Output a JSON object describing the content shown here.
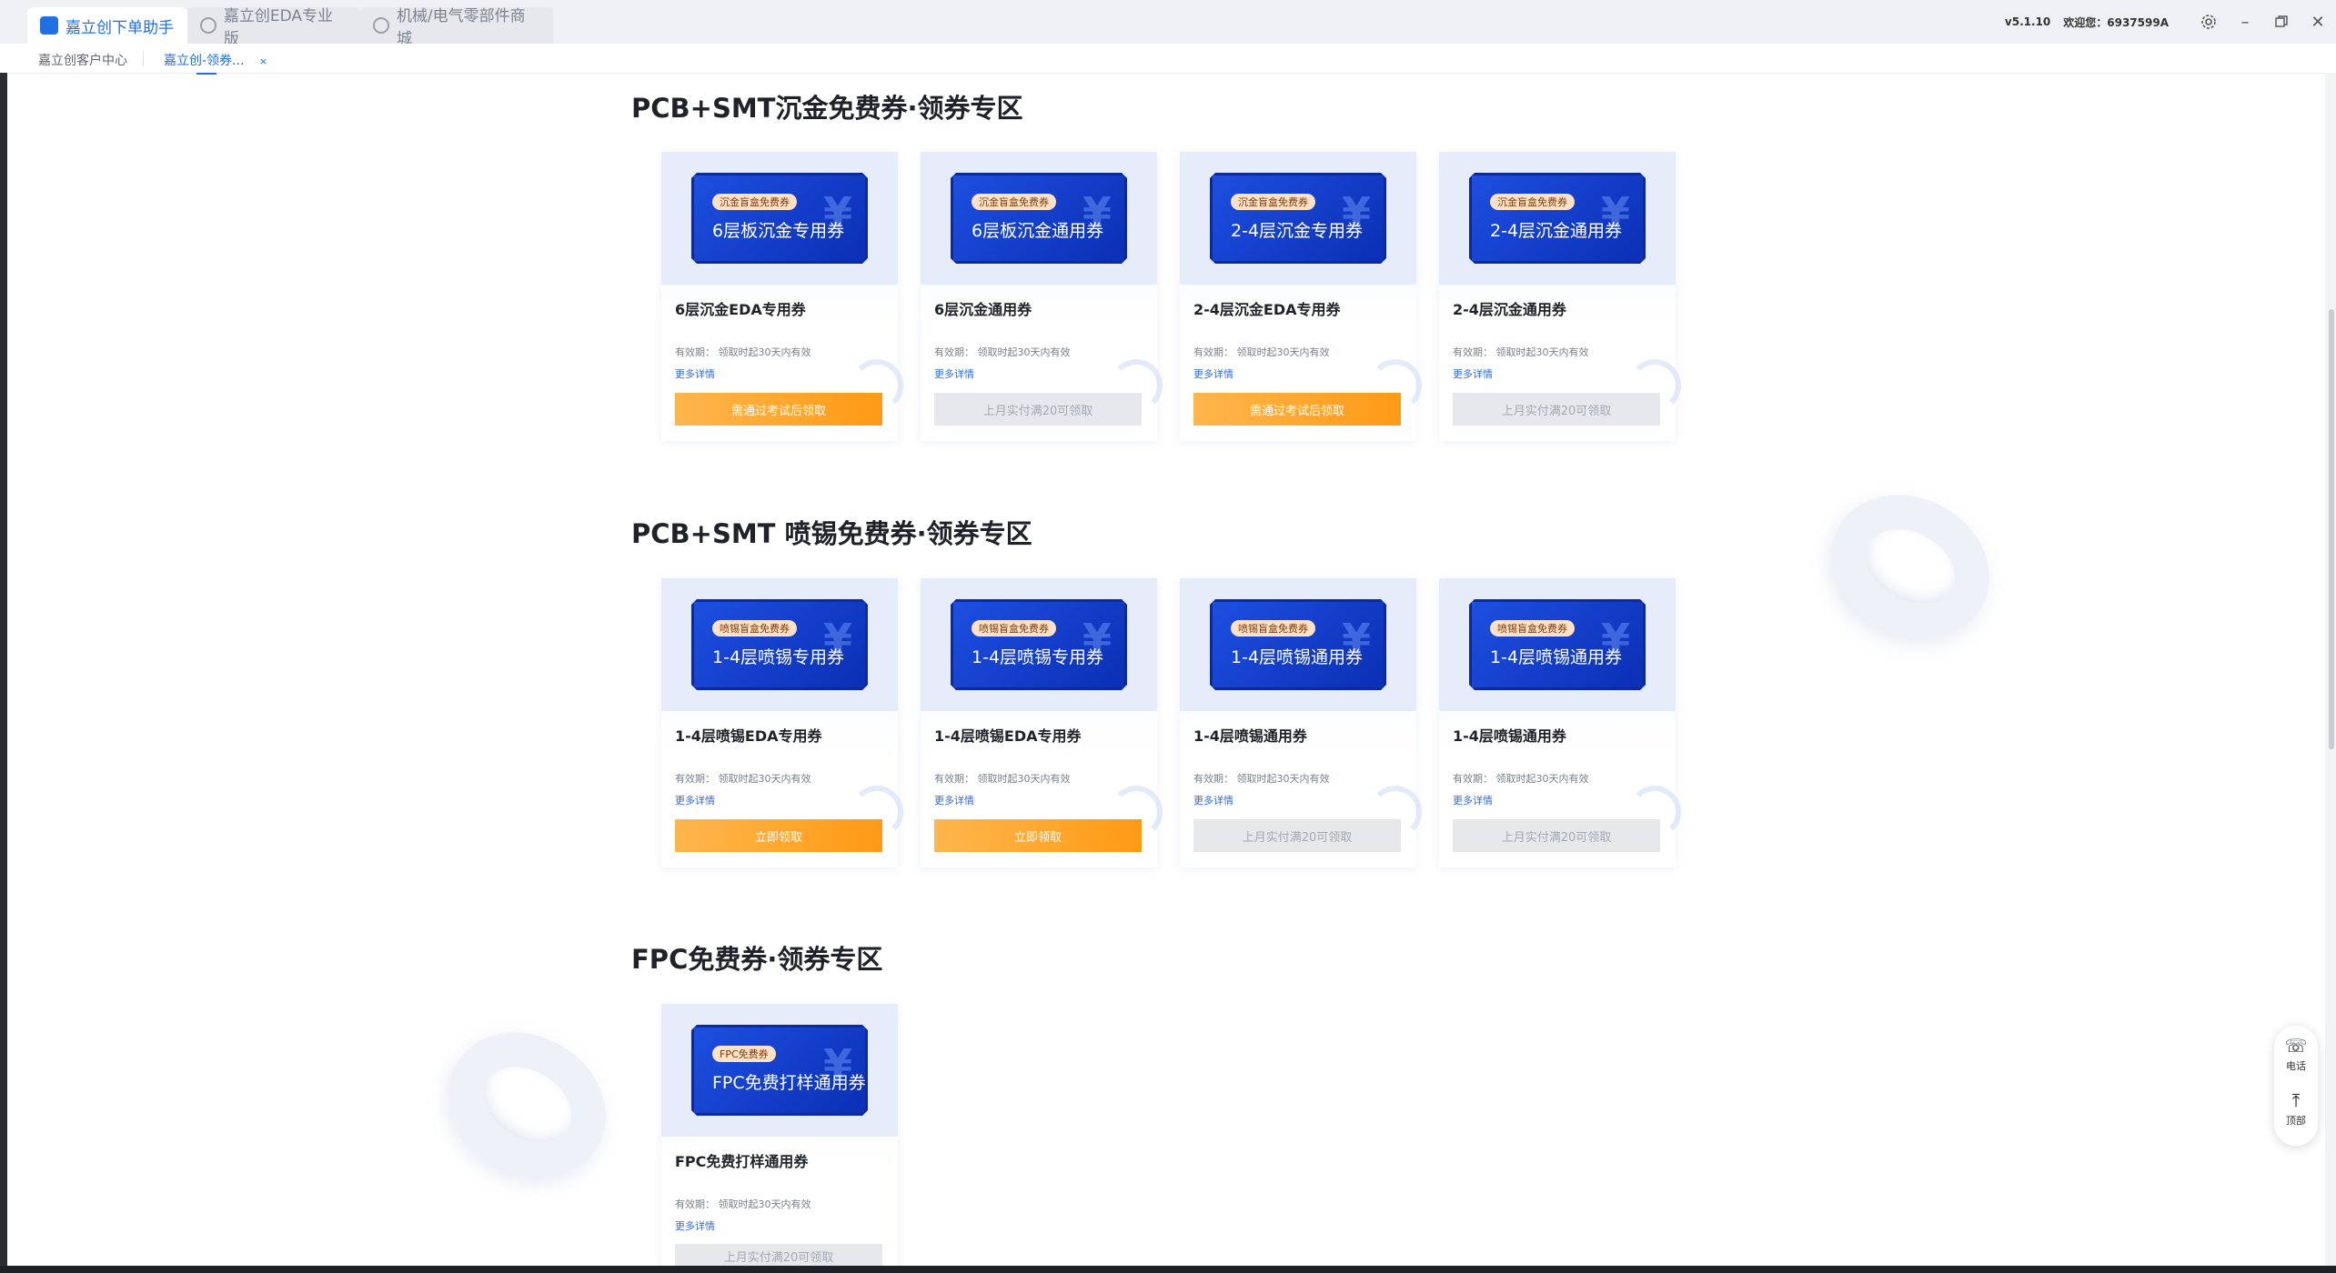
{
  "titlebar": {
    "tabs": [
      {
        "label": "嘉立创下单助手",
        "active": true
      },
      {
        "label": "嘉立创EDA专业版",
        "active": false
      },
      {
        "label": "机械/电气零部件商城",
        "active": false
      }
    ],
    "version": "v5.1.10",
    "welcome": "欢迎您：6937599A",
    "icons": [
      "settings-icon",
      "minimize-icon",
      "restore-icon",
      "close-icon"
    ]
  },
  "subtabs": [
    {
      "label": "嘉立创客户中心"
    },
    {
      "label": "嘉立创-领券...",
      "close": "×"
    }
  ],
  "sections": [
    {
      "title": "PCB+SMT沉金免费券·领券专区",
      "cards": [
        {
          "pill": "沉金盲盒免费券",
          "ticket": "6层板沉金专用券",
          "yen": "¥",
          "name": "6层沉金EDA专用券",
          "valid": "有效期： 领取时起30天内有效",
          "more": "更多详情",
          "button": "需通过考试后领取",
          "style": "orange"
        },
        {
          "pill": "沉金盲盒免费券",
          "ticket": "6层板沉金通用券",
          "yen": "¥",
          "name": "6层沉金通用券",
          "valid": "有效期： 领取时起30天内有效",
          "more": "更多详情",
          "button": "上月实付满20可领取",
          "style": "gray"
        },
        {
          "pill": "沉金盲盒免费券",
          "ticket": "2-4层沉金专用券",
          "yen": "¥",
          "name": "2-4层沉金EDA专用券",
          "valid": "有效期： 领取时起30天内有效",
          "more": "更多详情",
          "button": "需通过考试后领取",
          "style": "orange"
        },
        {
          "pill": "沉金盲盒免费券",
          "ticket": "2-4层沉金通用券",
          "yen": "¥",
          "name": "2-4层沉金通用券",
          "valid": "有效期： 领取时起30天内有效",
          "more": "更多详情",
          "button": "上月实付满20可领取",
          "style": "gray"
        }
      ]
    },
    {
      "title": "PCB+SMT 喷锡免费券·领券专区",
      "cards": [
        {
          "pill": "喷锡盲盒免费券",
          "ticket": "1-4层喷锡专用券",
          "yen": "¥",
          "name": "1-4层喷锡EDA专用券",
          "valid": "有效期： 领取时起30天内有效",
          "more": "更多详情",
          "button": "立即领取",
          "style": "orange"
        },
        {
          "pill": "喷锡盲盒免费券",
          "ticket": "1-4层喷锡专用券",
          "yen": "¥",
          "name": "1-4层喷锡EDA专用券",
          "valid": "有效期： 领取时起30天内有效",
          "more": "更多详情",
          "button": "立即领取",
          "style": "orange"
        },
        {
          "pill": "喷锡盲盒免费券",
          "ticket": "1-4层喷锡通用券",
          "yen": "¥",
          "name": "1-4层喷锡通用券",
          "valid": "有效期： 领取时起30天内有效",
          "more": "更多详情",
          "button": "上月实付满20可领取",
          "style": "gray"
        },
        {
          "pill": "喷锡盲盒免费券",
          "ticket": "1-4层喷锡通用券",
          "yen": "¥",
          "name": "1-4层喷锡通用券",
          "valid": "有效期： 领取时起30天内有效",
          "more": "更多详情",
          "button": "上月实付满20可领取",
          "style": "gray"
        }
      ]
    },
    {
      "title": "FPC免费券·领券专区",
      "cards": [
        {
          "pill": "FPC免费券",
          "ticket": "FPC免费打样通用券",
          "yen": "¥",
          "name": "FPC免费打样通用券",
          "valid": "有效期： 领取时起30天内有效",
          "more": "更多详情",
          "button": "上月实付满20可领取",
          "style": "gray"
        }
      ]
    }
  ],
  "float_widget": {
    "phone": {
      "icon": "phone-icon",
      "label": "电话"
    },
    "top": {
      "icon": "back-to-top-icon",
      "label": "顶部"
    }
  },
  "colors": {
    "accent": "#1f6fe5",
    "ticket": "#1d4fe0",
    "orange": "#ff9a14",
    "disabled": "#e6e8ec"
  }
}
